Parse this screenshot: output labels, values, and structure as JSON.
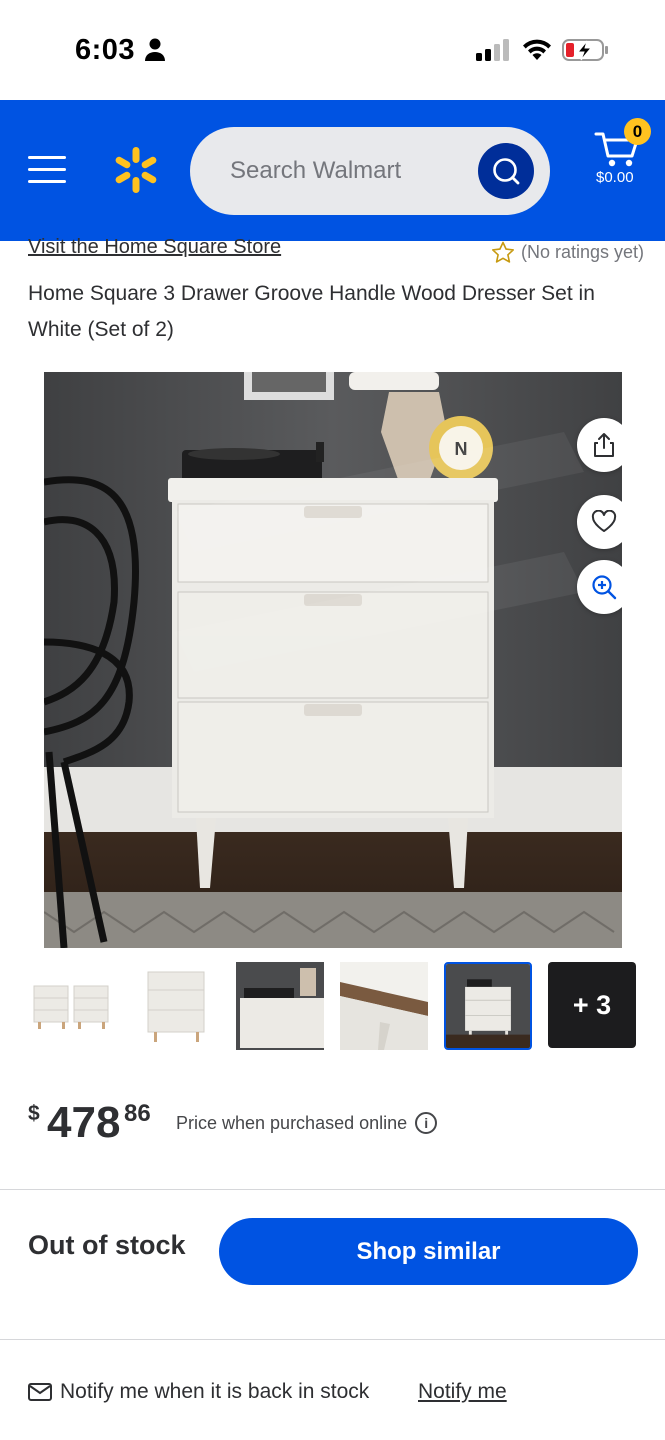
{
  "status_bar": {
    "time": "6:03"
  },
  "header": {
    "search_placeholder": "Search Walmart",
    "cart_count": "0",
    "cart_total": "$0.00",
    "brand_color": "#0053e2",
    "accent_color": "#ffc220"
  },
  "product": {
    "store_link": "Visit the Home Square Store",
    "ratings_text": "(No ratings yet)",
    "title": "Home Square 3 Drawer Groove Handle Wood Dresser Set in White (Set of 2)",
    "more_images_label": "+ 3",
    "selected_thumbnail": 5
  },
  "price": {
    "currency": "$",
    "dollars": "478",
    "cents": "86",
    "note": "Price when purchased online",
    "info_glyph": "i"
  },
  "availability": {
    "status": "Out of stock",
    "shop_similar": "Shop similar",
    "notify_text": "Notify me when it is back in stock",
    "notify_link": "Notify me"
  },
  "icons": [
    "person-icon",
    "signal-icon",
    "wifi-icon",
    "battery-charging-icon",
    "menu-icon",
    "walmart-spark-icon",
    "search-icon",
    "cart-icon",
    "star-icon",
    "share-icon",
    "heart-icon",
    "zoom-in-icon",
    "info-icon",
    "mail-icon"
  ]
}
